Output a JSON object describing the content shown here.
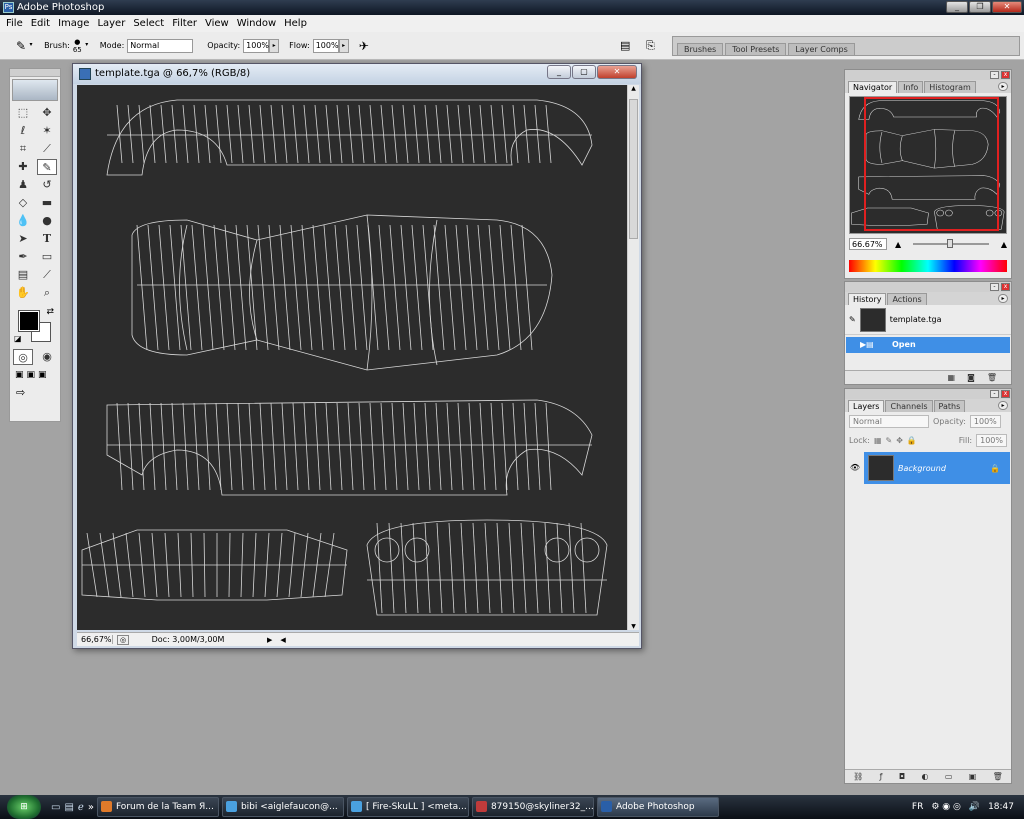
{
  "app": {
    "title": "Adobe Photoshop"
  },
  "menu": [
    "File",
    "Edit",
    "Image",
    "Layer",
    "Select",
    "Filter",
    "View",
    "Window",
    "Help"
  ],
  "options": {
    "brush_label": "Brush:",
    "brush_size": "65",
    "mode_label": "Mode:",
    "mode_value": "Normal",
    "opacity_label": "Opacity:",
    "opacity_value": "100%",
    "flow_label": "Flow:",
    "flow_value": "100%"
  },
  "palette_well": [
    "Brushes",
    "Tool Presets",
    "Layer Comps"
  ],
  "document": {
    "title": "template.tga @ 66,7% (RGB/8)",
    "zoom": "66,67%",
    "doc_size": "Doc: 3,00M/3,00M",
    "canvas_color": "#2c2c2c",
    "wire_color": "#d8d8d8"
  },
  "navigator": {
    "tabs": [
      "Navigator",
      "Info",
      "Histogram"
    ],
    "zoom": "66.67%",
    "frame_color": "#e02020",
    "zoom_level": 0.45
  },
  "history": {
    "tabs": [
      "History",
      "Actions"
    ],
    "snapshot": "template.tga",
    "steps": [
      "Open"
    ]
  },
  "layers": {
    "tabs": [
      "Layers",
      "Channels",
      "Paths"
    ],
    "blend_mode": "Normal",
    "opacity_label": "Opacity:",
    "opacity_value": "100%",
    "lock_label": "Lock:",
    "fill_label": "Fill:",
    "fill_value": "100%",
    "items": [
      "Background"
    ]
  },
  "taskbar": {
    "tasks": [
      "Forum de la Team Я...",
      "bibi <aiglefaucon@...",
      "[ Fire-SkuLL ] <meta...",
      "879150@skyliner32_...",
      "Adobe Photoshop"
    ],
    "active_task": "Adobe Photoshop",
    "lang": "FR",
    "clock": "18:47"
  },
  "colors": {
    "selection": "#3f8fe6",
    "foreground": "#000000",
    "background": "#ffffff"
  }
}
